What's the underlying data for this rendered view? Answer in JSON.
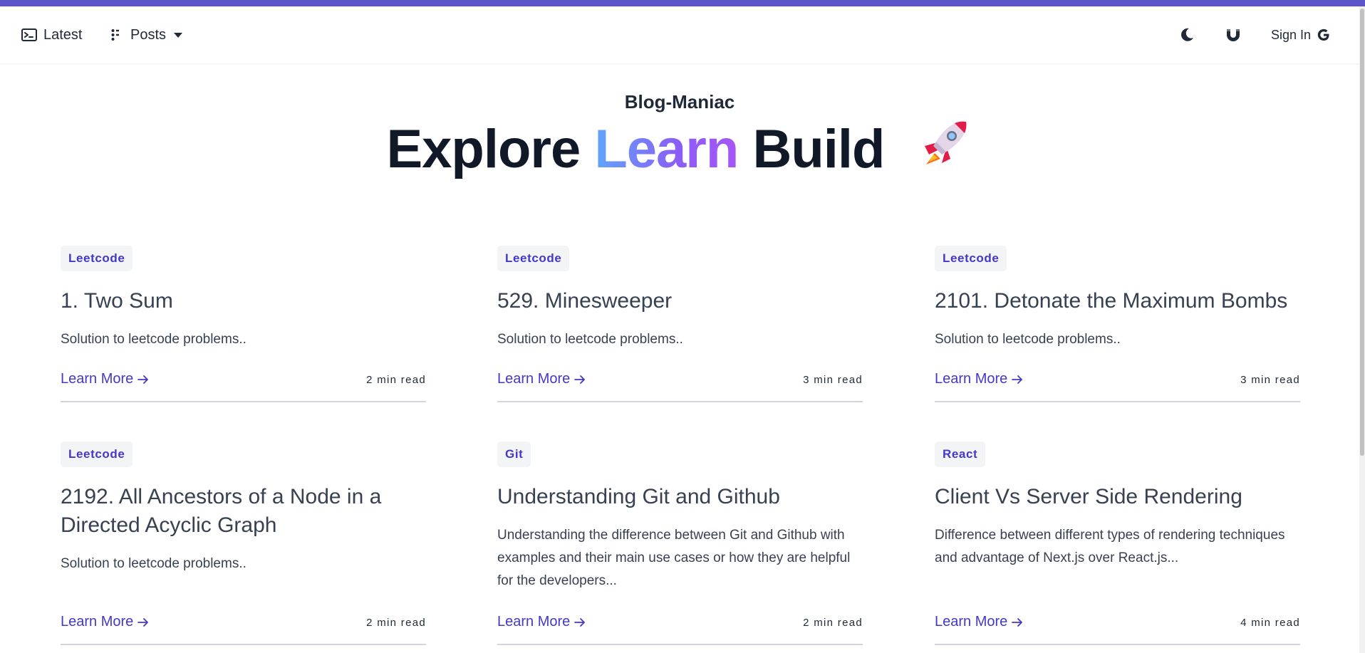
{
  "colors": {
    "accent_bar": "#5a55c8",
    "link": "#4338ca",
    "gradient_start": "#60a5fa",
    "gradient_end": "#a855f7"
  },
  "nav": {
    "latest_label": "Latest",
    "posts_label": "Posts",
    "signin_label": "Sign In",
    "icons": {
      "latest": "terminal-icon",
      "posts": "list-icon",
      "posts_caret": "caret-down-icon",
      "theme": "moon-icon",
      "gh": "magnet-icon",
      "signin": "google-icon"
    }
  },
  "hero": {
    "subtitle": "Blog-Maniac",
    "title_part1": "Explore",
    "title_highlight": "Learn",
    "title_part2": "Build",
    "emoji": "rocket-icon"
  },
  "posts": [
    {
      "tag": "Leetcode",
      "title": "1. Two Sum",
      "description": "Solution to leetcode problems..",
      "link_label": "Learn More",
      "read_time": "2 min read"
    },
    {
      "tag": "Leetcode",
      "title": "529. Minesweeper",
      "description": "Solution to leetcode problems..",
      "link_label": "Learn More",
      "read_time": "3 min read"
    },
    {
      "tag": "Leetcode",
      "title": "2101. Detonate the Maximum Bombs",
      "description": "Solution to leetcode problems..",
      "link_label": "Learn More",
      "read_time": "3 min read"
    },
    {
      "tag": "Leetcode",
      "title": "2192. All Ancestors of a Node in a Directed Acyclic Graph",
      "description": "Solution to leetcode problems..",
      "link_label": "Learn More",
      "read_time": "2 min read"
    },
    {
      "tag": "Git",
      "title": "Understanding Git and Github",
      "description": "Understanding the difference between Git and Github with examples and their main use cases or how they are helpful for the developers...",
      "link_label": "Learn More",
      "read_time": "2 min read"
    },
    {
      "tag": "React",
      "title": "Client Vs Server Side Rendering",
      "description": "Difference between different types of rendering techniques and advantage of Next.js over React.js...",
      "link_label": "Learn More",
      "read_time": "4 min read"
    }
  ]
}
